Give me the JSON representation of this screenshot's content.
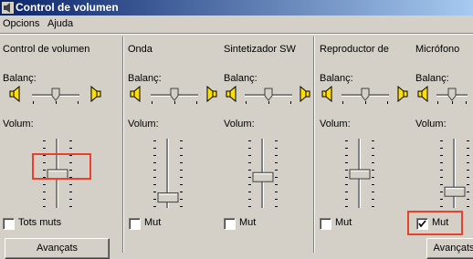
{
  "window": {
    "title": "Control de volumen",
    "icon": "speaker-app-icon"
  },
  "menu": {
    "items": [
      "Opcions",
      "Ajuda"
    ]
  },
  "labels": {
    "balance": "Balanç:",
    "volume": "Volum:"
  },
  "channels": [
    {
      "name": "Control de volumen",
      "mute_label": "Tots muts",
      "muted": false,
      "advanced_label": "Avançats",
      "balance_level": 0.5,
      "volume_level": 0.5
    },
    {
      "name": "Onda",
      "mute_label": "Mut",
      "muted": false,
      "balance_level": 0.5,
      "volume_level": 0.1
    },
    {
      "name": "Sintetizador SW",
      "mute_label": "Mut",
      "muted": false,
      "balance_level": 0.5,
      "volume_level": 0.45
    },
    {
      "name": "Reproductor de",
      "mute_label": "Mut",
      "muted": false,
      "balance_level": 0.5,
      "volume_level": 0.5
    },
    {
      "name": "Micrófono",
      "mute_label": "Mut",
      "muted": true,
      "advanced_label": "Avançats",
      "balance_level": 0.5,
      "volume_level": 0.2
    }
  ],
  "annotations": {
    "highlight_color": "#e8412c",
    "highlighted": [
      "volume-slider-master",
      "mute-checkbox-microphone"
    ]
  }
}
